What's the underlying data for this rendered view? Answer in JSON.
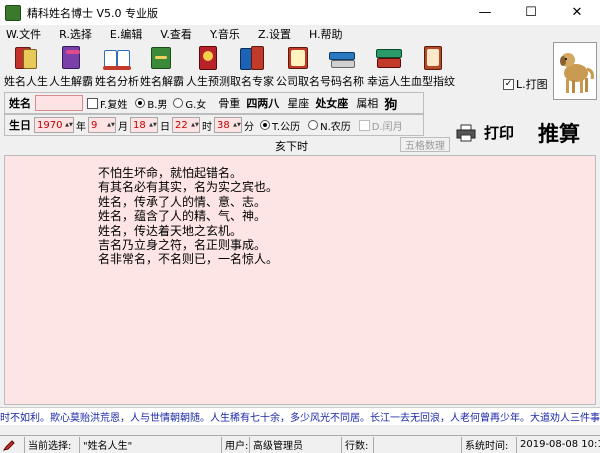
{
  "window": {
    "title": "精科姓名博士 V5.0 专业版",
    "min": "—",
    "max": "☐",
    "close": "✕"
  },
  "menu": [
    "W.文件",
    "R.选择",
    "E.编辑",
    "V.查看",
    "Y.音乐",
    "Z.设置",
    "H.帮助"
  ],
  "toolbar": [
    {
      "label": "姓名人生",
      "color": "#c2322b"
    },
    {
      "label": "人生解霸",
      "color": "#7a3fa8"
    },
    {
      "label": "姓名分析",
      "color": "#2f6fb8"
    },
    {
      "label": "姓名解霸",
      "color": "#3a8a3a"
    },
    {
      "label": "人生预测",
      "color": "#b8232a"
    },
    {
      "label": "取名专家",
      "color": "#1d63b5"
    },
    {
      "label": "公司取名",
      "color": "#c23a2a"
    },
    {
      "label": "号码名称",
      "color": "#2a7ac2"
    },
    {
      "label": "幸运人生",
      "color": "#2a9a6a"
    },
    {
      "label": "血型指纹",
      "color": "#b54a2a"
    }
  ],
  "print_option": "L.打图",
  "row1": {
    "name_label": "姓名",
    "name_value": "",
    "fuxing": "F.复姓",
    "male": "B.男",
    "female": "G.女",
    "weight": "骨重",
    "weight_value": "四两八",
    "star": "星座",
    "star_value": "处女座",
    "zodiac": "属相",
    "zodiac_value": "狗"
  },
  "row2": {
    "birth_label": "生日",
    "year": "1970",
    "year_unit": "年",
    "month": "9",
    "month_unit": "月",
    "day": "18",
    "day_unit": "日",
    "hour": "22",
    "hour_unit": "时",
    "minute": "38",
    "minute_unit": "分",
    "solar": "T.公历",
    "lunar": "N.农历",
    "leap": "D.闰月"
  },
  "shichen": "亥下时",
  "wuge_button": "五格数理",
  "print_button": "打印",
  "calc_button": "推算",
  "poem": [
    "不怕生坏命，就怕起错名。",
    "有其名必有其实，名为实之宾也。",
    "姓名，传承了人的情、意、志。",
    "姓名，蕴含了人的精、气、神。",
    "姓名，传达着天地之玄机。",
    "吉名乃立身之符，名正则事成。",
    "名非常名，不名则已，一名惊人。"
  ],
  "marquee": "时不如利。欺心莫贻洪荒恩，人与世情朝朝随。人生稀有七十余，多少风光不同居。长江一去无回浪，人老何曾再少年。大道劝人三件事",
  "status": {
    "current_label": "当前选择:",
    "current_value": "\"姓名人生\"",
    "user_label": "用户:",
    "user_value": "高级管理员",
    "rows_label": "行数:",
    "time_label": "系统时间:",
    "time_value": "2019-08-08 10:16"
  }
}
